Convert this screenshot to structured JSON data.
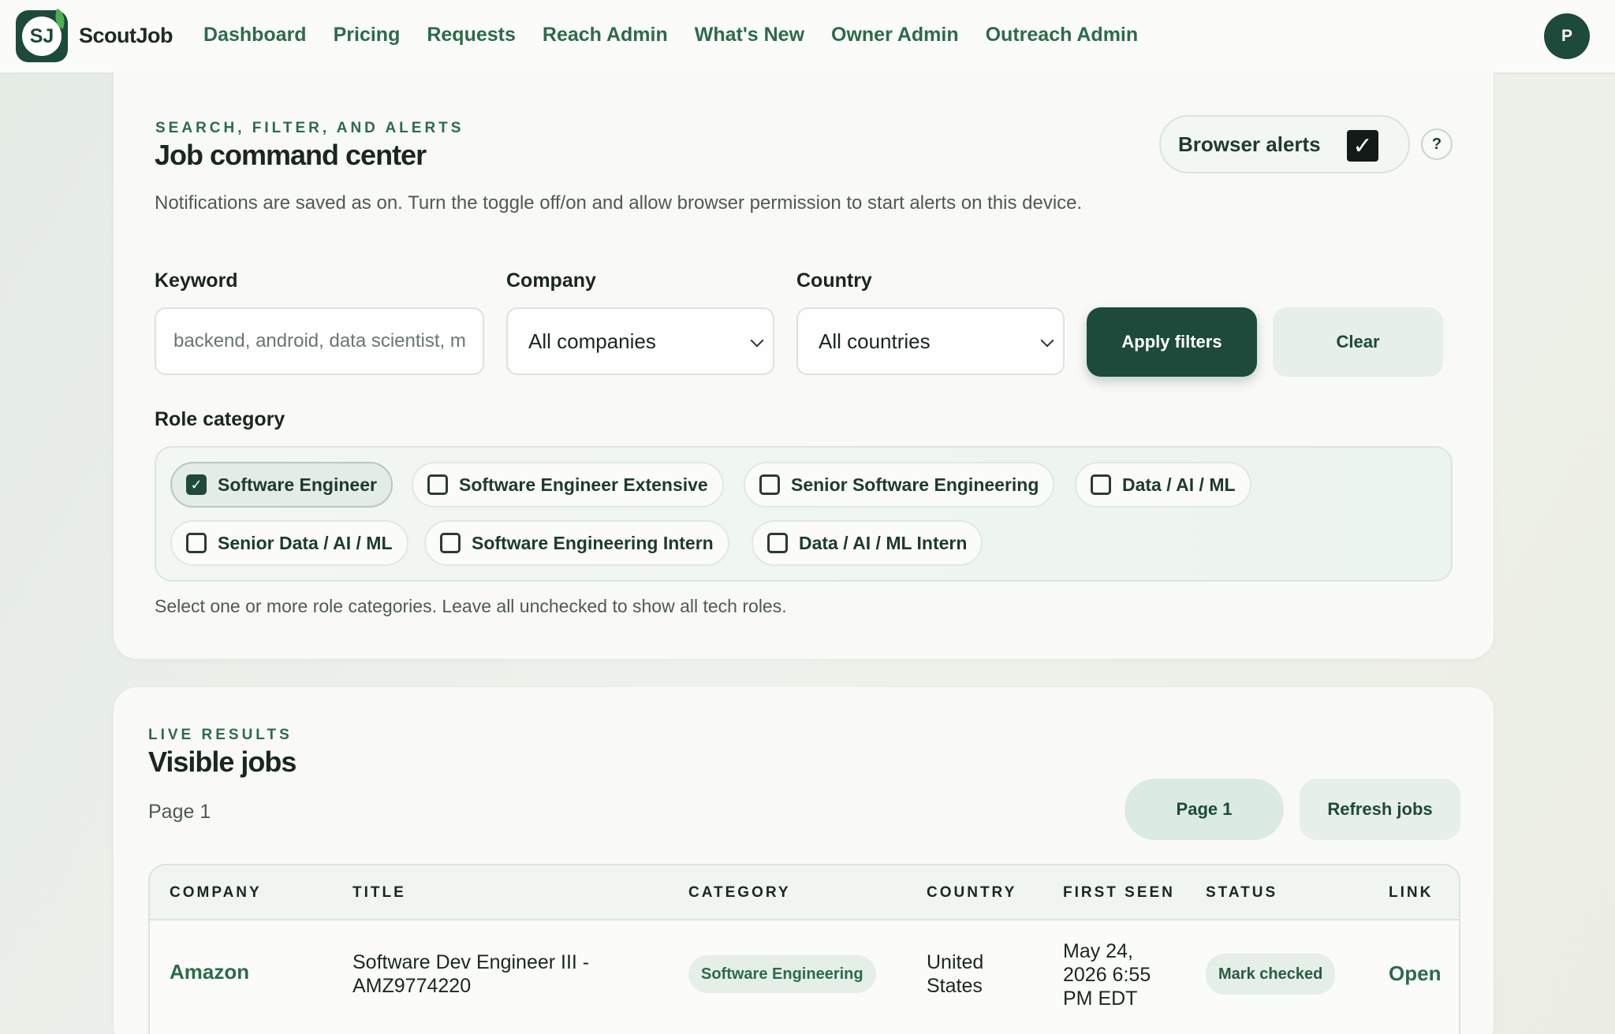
{
  "nav": {
    "logo_text": "SJ",
    "brand": "ScoutJob",
    "links": [
      "Dashboard",
      "Pricing",
      "Requests",
      "Reach Admin",
      "What's New",
      "Owner Admin",
      "Outreach Admin"
    ],
    "avatar_initial": "P"
  },
  "filters": {
    "eyebrow": "SEARCH, FILTER, AND ALERTS",
    "title": "Job command center",
    "notice": "Notifications are saved as on. Turn the toggle off/on and allow browser permission to start alerts on this device.",
    "alerts_label": "Browser alerts",
    "alerts_checked": true,
    "help_label": "?",
    "keyword_label": "Keyword",
    "keyword_placeholder": "backend, android, data scientist, ml",
    "keyword_value": "",
    "company_label": "Company",
    "company_value": "All companies",
    "country_label": "Country",
    "country_value": "All countries",
    "apply_label": "Apply filters",
    "clear_label": "Clear",
    "role_label": "Role category",
    "roles": [
      {
        "label": "Software Engineer",
        "checked": true
      },
      {
        "label": "Software Engineer Extensive",
        "checked": false
      },
      {
        "label": "Senior Software Engineering",
        "checked": false
      },
      {
        "label": "Data / AI / ML",
        "checked": false
      },
      {
        "label": "Senior Data / AI / ML",
        "checked": false
      },
      {
        "label": "Software Engineering Intern",
        "checked": false
      },
      {
        "label": "Data / AI / ML Intern",
        "checked": false
      }
    ],
    "role_hint": "Select one or more role categories. Leave all unchecked to show all tech roles."
  },
  "results": {
    "eyebrow": "LIVE RESULTS",
    "title": "Visible jobs",
    "page_text": "Page 1",
    "page_button": "Page 1",
    "refresh_button": "Refresh jobs",
    "columns": [
      "COMPANY",
      "TITLE",
      "CATEGORY",
      "COUNTRY",
      "FIRST SEEN",
      "STATUS",
      "LINK"
    ],
    "rows": [
      {
        "company": "Amazon",
        "title_line1": "Software Dev Engineer III -",
        "title_line2": "AMZ9774220",
        "category": "Software Engineering",
        "country_line1": "United",
        "country_line2": "States",
        "first_seen_line1": "May 24,",
        "first_seen_line2": "2026 6:55",
        "first_seen_line3": "PM EDT",
        "status": "Mark checked",
        "link": "Open"
      }
    ]
  }
}
